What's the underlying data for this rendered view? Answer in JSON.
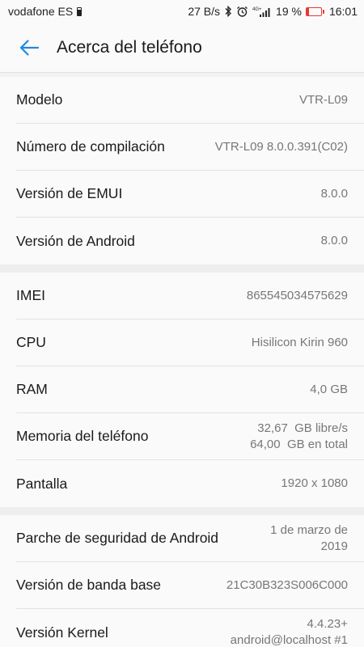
{
  "status_bar": {
    "carrier": "vodafone ES",
    "net_speed": "27 B/s",
    "network_type": "4G+",
    "battery_percent": "19 %",
    "battery_level": 0.19,
    "time": "16:01",
    "icons": [
      "sim-battery-icon",
      "bluetooth-icon",
      "alarm-icon",
      "signal-icon",
      "battery-icon"
    ]
  },
  "app_bar": {
    "title": "Acerca del teléfono",
    "back_icon": "arrow-left-icon",
    "accent_color": "#1e88e5"
  },
  "sections": [
    {
      "rows": [
        {
          "label": "Modelo",
          "value": [
            "VTR-L09"
          ]
        },
        {
          "label": "Número de compilación",
          "value": [
            "VTR-L09 8.0.0.391(C02)"
          ]
        },
        {
          "label": "Versión de EMUI",
          "value": [
            "8.0.0"
          ]
        },
        {
          "label": "Versión de Android",
          "value": [
            "8.0.0"
          ]
        }
      ]
    },
    {
      "rows": [
        {
          "label": "IMEI",
          "value": [
            "865545034575629"
          ]
        },
        {
          "label": "CPU",
          "value": [
            "Hisilicon Kirin 960"
          ]
        },
        {
          "label": "RAM",
          "value": [
            "4,0 GB"
          ]
        },
        {
          "label": "Memoria del teléfono",
          "value": [
            "32,67  GB libre/s",
            "64,00  GB en total"
          ]
        },
        {
          "label": "Pantalla",
          "value": [
            "1920 x 1080"
          ]
        }
      ]
    },
    {
      "rows": [
        {
          "label": "Parche de seguridad de Android",
          "value": [
            "1 de marzo de",
            "2019"
          ]
        },
        {
          "label": "Versión de banda base",
          "value": [
            "21C30B323S006C000"
          ]
        },
        {
          "label": "Versión Kernel",
          "value": [
            "4.4.23+",
            "android@localhost #1"
          ]
        }
      ]
    }
  ]
}
